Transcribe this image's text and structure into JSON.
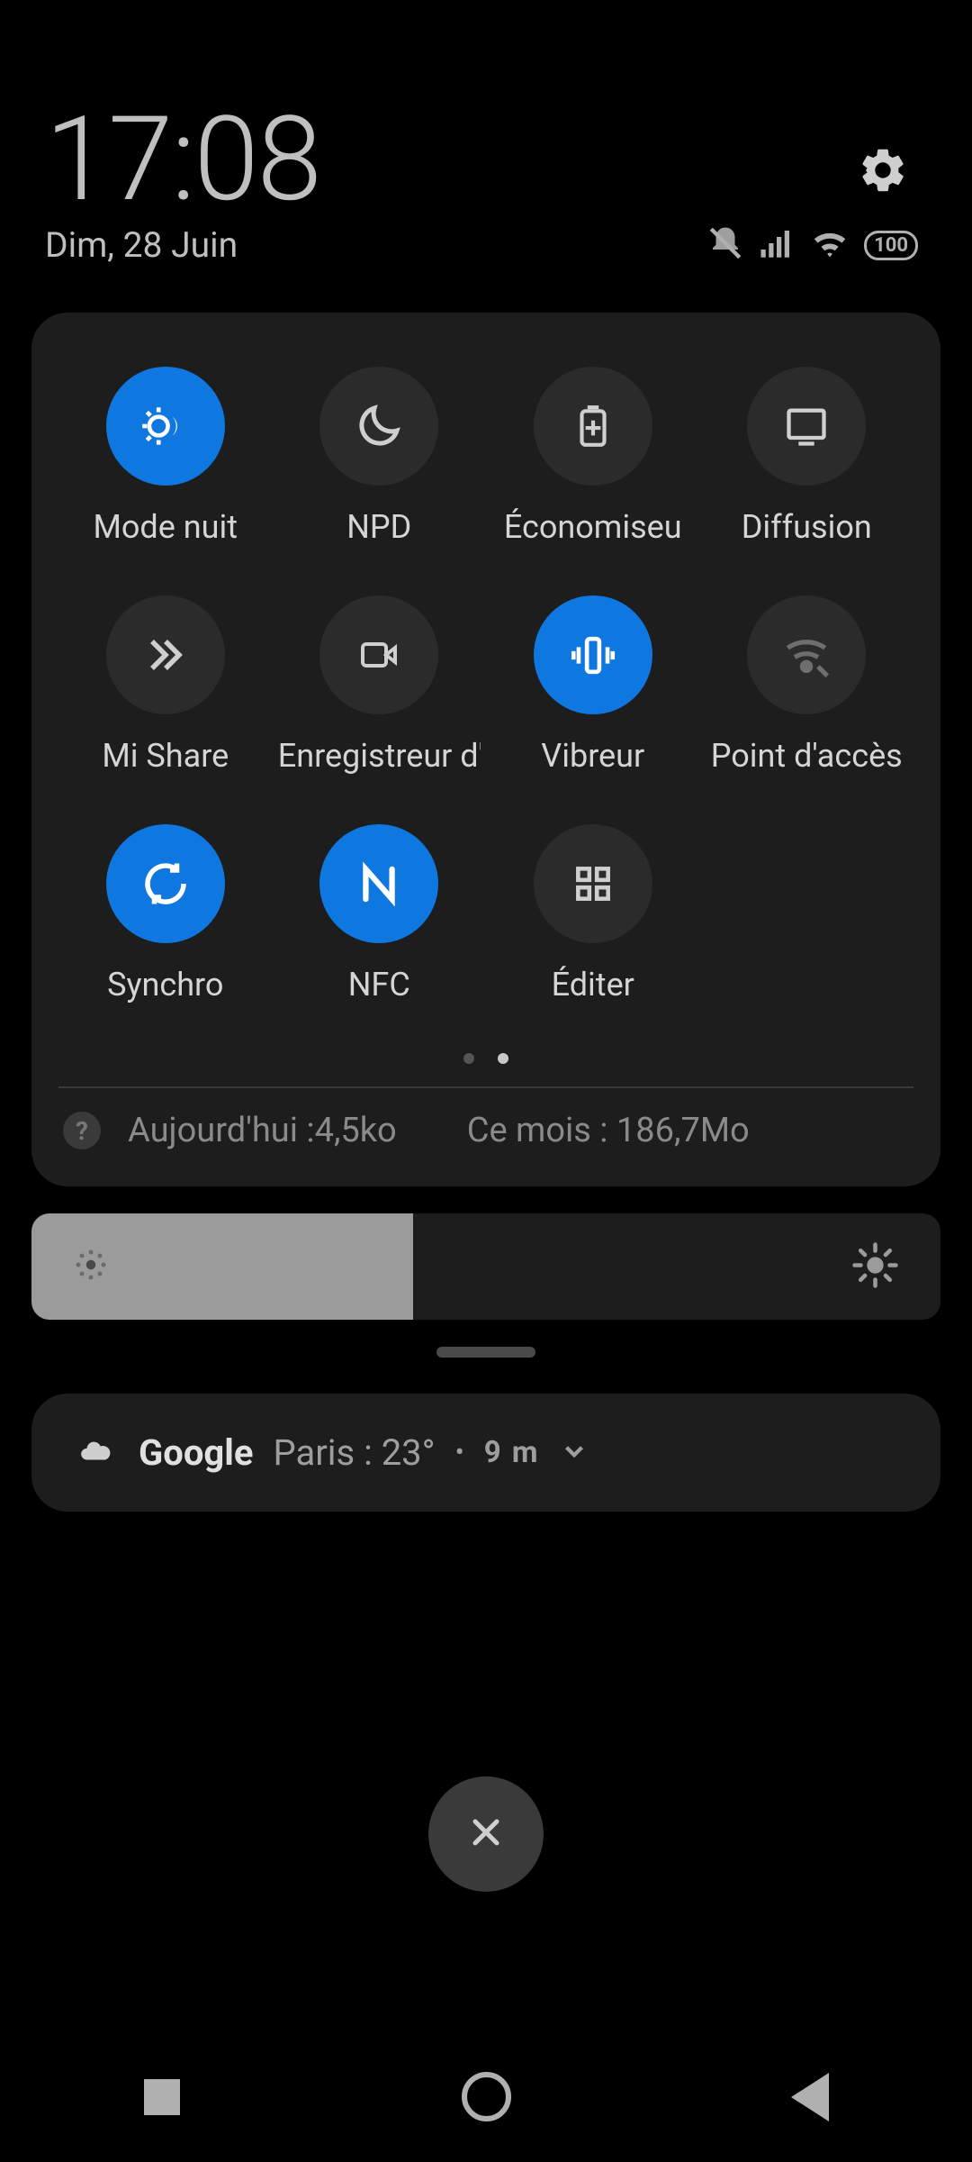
{
  "header": {
    "time": "17:08",
    "date": "Dim, 28 Juin",
    "battery": "100"
  },
  "tiles": [
    {
      "label": "Mode nuit",
      "active": true
    },
    {
      "label": "NPD",
      "active": false
    },
    {
      "label": "Économiseu",
      "active": false
    },
    {
      "label": "Diffusion",
      "active": false
    },
    {
      "label": "Mi Share",
      "active": false
    },
    {
      "label": "Enregistreur d'éc",
      "active": false
    },
    {
      "label": "Vibreur",
      "active": true
    },
    {
      "label": "Point d'accès",
      "active": false
    },
    {
      "label": "Synchro",
      "active": true
    },
    {
      "label": "NFC",
      "active": true
    },
    {
      "label": "Éditer",
      "active": false
    }
  ],
  "data_usage": {
    "today": "Aujourd'hui :4,5ko",
    "month": "Ce mois : 186,7Mo"
  },
  "brightness": {
    "percent": 42
  },
  "notification": {
    "app": "Google",
    "text": "Paris : 23°",
    "time": "9 m"
  }
}
